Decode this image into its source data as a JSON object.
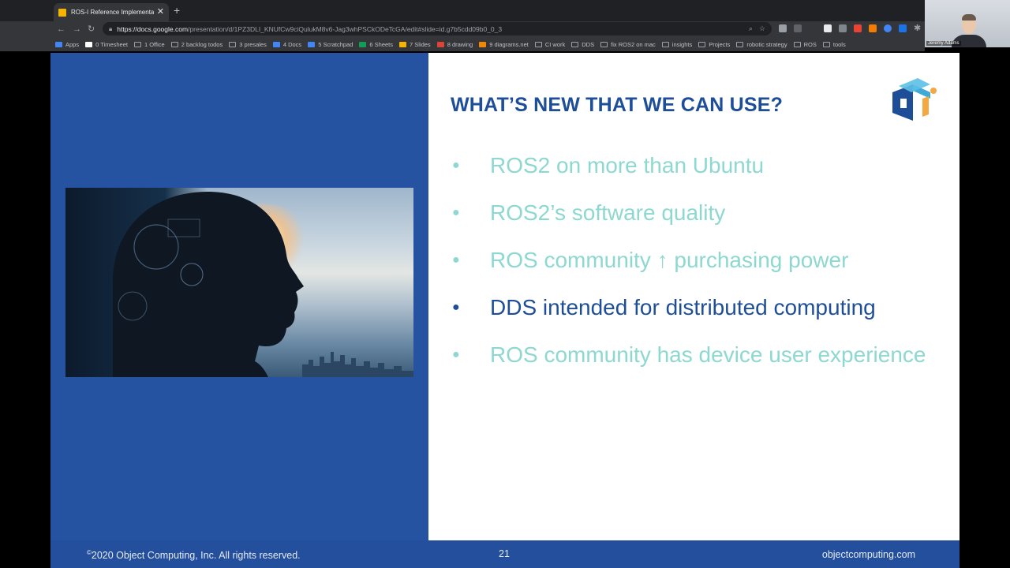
{
  "browser": {
    "tab_title": "ROS-I Reference Implementatio",
    "tab_close": "✕",
    "new_tab": "+",
    "url_host": "https://docs.google.com",
    "url_path": "/presentation/d/1PZ3DLI_KNUfCw9ciQulukM8v6-Jag3whPSCkODeTcGA/edit#slide=id.g7b5cdd09b0_0_3"
  },
  "bookmarks": [
    {
      "label": "Apps",
      "color": "#4285f4"
    },
    {
      "label": "0 Timesheet",
      "color": "#ffffff"
    },
    {
      "label": "1 Office",
      "color": ""
    },
    {
      "label": "2 backlog todos",
      "color": ""
    },
    {
      "label": "3 presales",
      "color": ""
    },
    {
      "label": "4 Docs",
      "color": "#4285f4"
    },
    {
      "label": "5 Scratchpad",
      "color": "#4285f4"
    },
    {
      "label": "6 Sheets",
      "color": "#0f9d58"
    },
    {
      "label": "7 Slides",
      "color": "#f4b400"
    },
    {
      "label": "8 drawing",
      "color": "#db4437"
    },
    {
      "label": "9 diagrams.net",
      "color": "#f08705"
    },
    {
      "label": "CI work",
      "color": ""
    },
    {
      "label": "DDS",
      "color": ""
    },
    {
      "label": "fix ROS2 on mac",
      "color": ""
    },
    {
      "label": "insights",
      "color": ""
    },
    {
      "label": "Projects",
      "color": ""
    },
    {
      "label": "robotic strategy",
      "color": ""
    },
    {
      "label": "ROS",
      "color": ""
    },
    {
      "label": "tools",
      "color": ""
    }
  ],
  "webcam": {
    "name": "Jeremy Adams"
  },
  "slide": {
    "title": "WHAT’S NEW THAT WE CAN USE?",
    "bullets": [
      "ROS2 on more than Ubuntu",
      "ROS2’s software quality",
      "ROS community ↑ purchasing power",
      "DDS intended for distributed computing",
      "ROS community has device user experience"
    ],
    "active_bullet": 3,
    "colors": {
      "title": "#1f4e99",
      "muted": "#8dd8d0",
      "active": "#1f4e99",
      "band": "#234f9c"
    },
    "footer": {
      "copyright_symbol": "©",
      "copyright": "2020 Object Computing, Inc. All rights reserved.",
      "page_number": "21",
      "website": "objectcomputing.com"
    }
  }
}
